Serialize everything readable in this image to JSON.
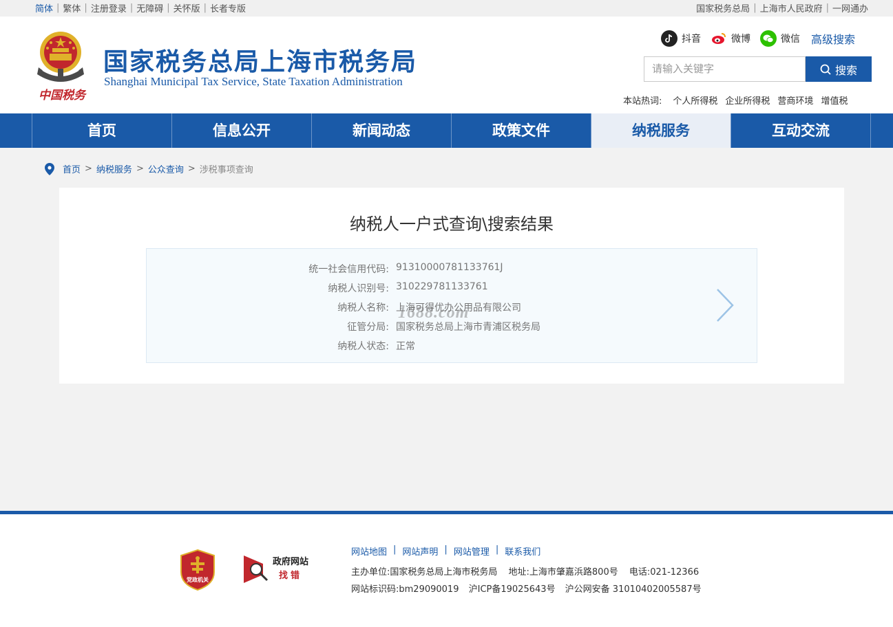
{
  "topbar": {
    "left": [
      "简体",
      "繁体",
      "注册登录",
      "无障碍",
      "关怀版",
      "长者专版"
    ],
    "right": [
      "国家税务总局",
      "上海市人民政府",
      "一网通办"
    ]
  },
  "header": {
    "title": "国家税务总局上海市税务局",
    "subtitle": "Shanghai Municipal Tax Service, State Taxation Administration",
    "emblem_caption": "中国税务"
  },
  "social": {
    "douyin": "抖音",
    "weibo": "微博",
    "wechat": "微信",
    "advanced_search": "高级搜索"
  },
  "search": {
    "placeholder": "请输入关键字",
    "button": "搜索"
  },
  "hot": {
    "label": "本站热词:",
    "keywords": [
      "个人所得税",
      "企业所得税",
      "营商环境",
      "增值税"
    ]
  },
  "nav": {
    "items": [
      "首页",
      "信息公开",
      "新闻动态",
      "政策文件",
      "纳税服务",
      "互动交流"
    ],
    "active_index": 4
  },
  "breadcrumb": {
    "items": [
      "首页",
      "纳税服务",
      "公众查询"
    ],
    "current": "涉税事项查询"
  },
  "result": {
    "title": "纳税人一户式查询\\搜索结果",
    "fields": [
      {
        "label": "统一社会信用代码:",
        "value": "91310000781133761J"
      },
      {
        "label": "纳税人识别号:",
        "value": "310229781133761"
      },
      {
        "label": "纳税人名称:",
        "value": "上海可得优办公用品有限公司"
      },
      {
        "label": "征管分局:",
        "value": "国家税务总局上海市青浦区税务局"
      },
      {
        "label": "纳税人状态:",
        "value": "正常"
      }
    ],
    "watermark": "1688.com"
  },
  "footer": {
    "links": [
      "网站地图",
      "网站声明",
      "网站管理",
      "联系我们"
    ],
    "badge_text": "党政机关",
    "gov_find_line1": "政府网站",
    "gov_find_line2": "找错",
    "host": "主办单位:国家税务总局上海市税务局",
    "address": "地址:上海市肇嘉浜路800号",
    "phone": "电话:021-12366",
    "site_id": "网站标识码:bm29090019",
    "icp": "沪ICP备19025643号",
    "police": "沪公网安备 31010402005587号"
  },
  "colors": {
    "brand_blue": "#1a5aa8",
    "nav_active_bg": "#e9eef6",
    "emblem_red": "#c1272d",
    "emblem_gold": "#e0b12a"
  }
}
